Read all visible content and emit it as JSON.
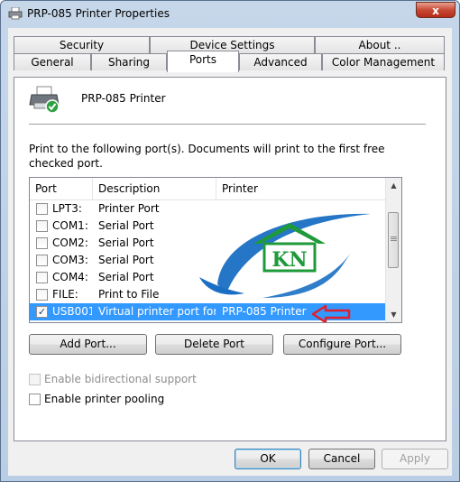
{
  "window": {
    "title": "PRP-085 Printer Properties",
    "close_label": "x"
  },
  "tabs": {
    "top_row": [
      {
        "label": "Security"
      },
      {
        "label": "Device Settings"
      },
      {
        "label": "About .."
      }
    ],
    "bottom_row": [
      {
        "label": "General"
      },
      {
        "label": "Sharing"
      },
      {
        "label": "Ports",
        "active": true
      },
      {
        "label": "Advanced"
      },
      {
        "label": "Color Management"
      }
    ]
  },
  "panel": {
    "printer_name": "PRP-085 Printer",
    "instructions": "Print to the following port(s). Documents will print to the first free checked port."
  },
  "ports_table": {
    "columns": [
      "Port",
      "Description",
      "Printer"
    ],
    "rows": [
      {
        "port": "LPT3:",
        "description": "Printer Port",
        "printer": "",
        "checked": false
      },
      {
        "port": "COM1:",
        "description": "Serial Port",
        "printer": "",
        "checked": false
      },
      {
        "port": "COM2:",
        "description": "Serial Port",
        "printer": "",
        "checked": false
      },
      {
        "port": "COM3:",
        "description": "Serial Port",
        "printer": "",
        "checked": false
      },
      {
        "port": "COM4:",
        "description": "Serial Port",
        "printer": "",
        "checked": false
      },
      {
        "port": "FILE:",
        "description": "Print to File",
        "printer": "",
        "checked": false
      },
      {
        "port": "USB001",
        "description": "Virtual printer port for...",
        "printer": "PRP-085 Printer",
        "checked": true,
        "selected": true
      }
    ],
    "watermark_text": "KN"
  },
  "port_buttons": {
    "add": "Add Port...",
    "delete": "Delete Port",
    "configure": "Configure Port..."
  },
  "options": {
    "bidirectional": {
      "label": "Enable bidirectional support",
      "checked": false,
      "enabled": false
    },
    "pooling": {
      "label": "Enable printer pooling",
      "checked": false,
      "enabled": true
    }
  },
  "dialog_buttons": {
    "ok": "OK",
    "cancel": "Cancel",
    "apply": "Apply"
  },
  "colors": {
    "selection": "#3399ff",
    "annotation_arrow": "#e0202a",
    "watermark_blue": "#1a6fc4",
    "watermark_green": "#1f9a3a"
  }
}
